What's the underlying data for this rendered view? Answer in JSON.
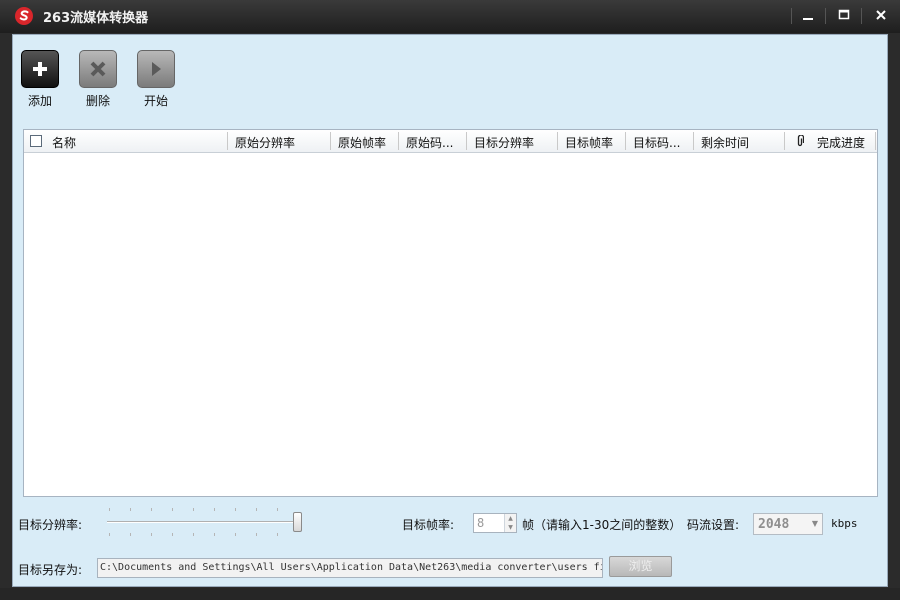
{
  "window": {
    "title": "263流媒体转换器",
    "controls": {
      "minimize": "minimize-icon",
      "maximize": "maximize-icon",
      "close": "close-icon"
    }
  },
  "toolbar": {
    "add_label": "添加",
    "delete_label": "删除",
    "start_label": "开始"
  },
  "table": {
    "columns": [
      "名称",
      "原始分辨率",
      "原始帧率",
      "原始码...",
      "目标分辨率",
      "目标帧率",
      "目标码...",
      "剩余时间",
      "完成进度"
    ],
    "rows": []
  },
  "settings": {
    "resolution_label": "目标分辨率:",
    "framerate_label": "目标帧率:",
    "framerate_value": "8",
    "framerate_hint": "帧（请输入1-30之间的整数）",
    "bitrate_label": "码流设置:",
    "bitrate_value": "2048",
    "bitrate_unit": "kbps",
    "saveas_label": "目标另存为:",
    "saveas_path": "C:\\Documents and Settings\\All Users\\Application Data\\Net263\\media converter\\users fi",
    "browse_label": "浏览"
  },
  "colors": {
    "client_bg": "#d9ecf7",
    "titlebar": "#1e1e1e",
    "logo": "#d9262b"
  }
}
